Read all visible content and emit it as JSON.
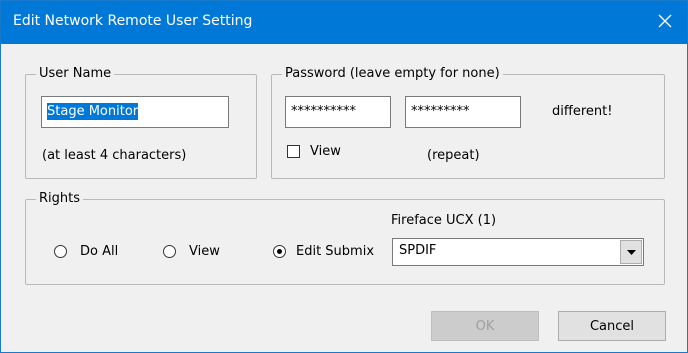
{
  "window": {
    "title": "Edit Network Remote User Setting",
    "accent_color": "#0078d7",
    "close_icon": "close-icon"
  },
  "user_name": {
    "legend": "User Name",
    "value": "Stage Monitor",
    "hint": "(at least 4 characters)"
  },
  "password": {
    "legend": "Password (leave empty for none)",
    "value": "**********",
    "repeat_value": "*********",
    "status": "different!",
    "view_label": "View",
    "view_checked": false,
    "repeat_label": "(repeat)"
  },
  "rights": {
    "legend": "Rights",
    "options": [
      {
        "label": "Do All",
        "checked": false
      },
      {
        "label": "View",
        "checked": false
      },
      {
        "label": "Edit Submix",
        "checked": true
      }
    ],
    "device_label": "Fireface UCX (1)",
    "submix_value": "SPDIF"
  },
  "buttons": {
    "ok": "OK",
    "cancel": "Cancel"
  }
}
